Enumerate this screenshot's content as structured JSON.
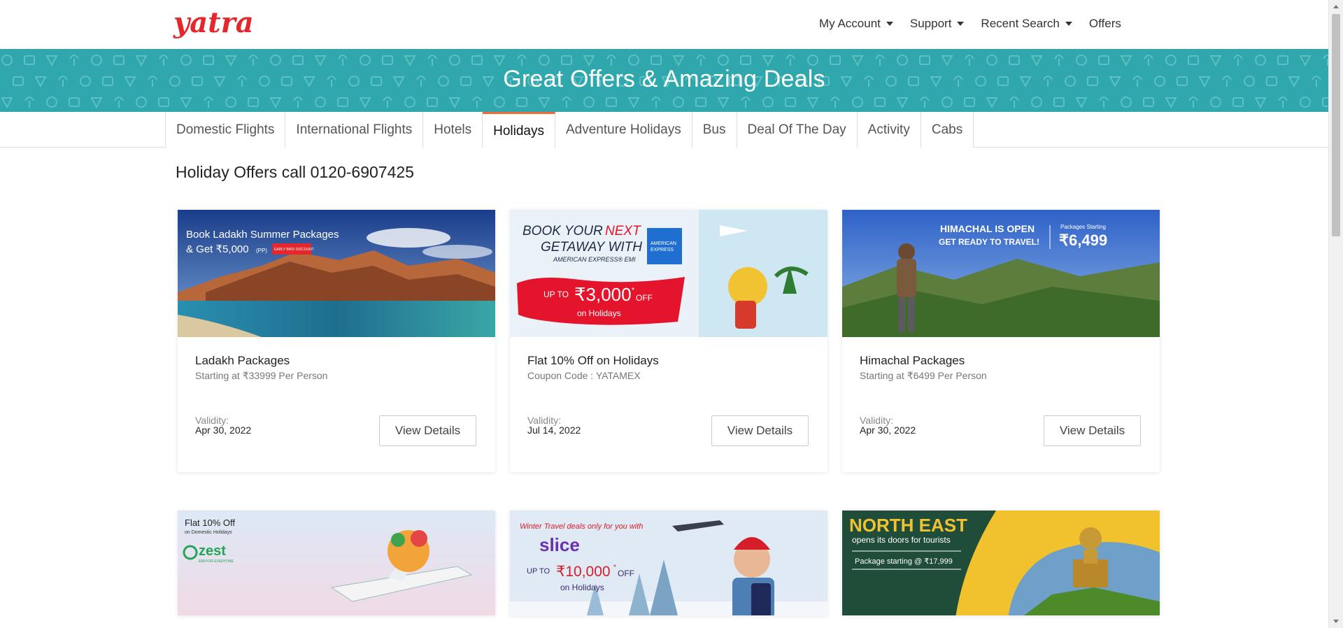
{
  "header": {
    "logo_text": "yatra",
    "nav": [
      {
        "label": "My Account",
        "dropdown": true
      },
      {
        "label": "Support",
        "dropdown": true
      },
      {
        "label": "Recent Search",
        "dropdown": true
      },
      {
        "label": "Offers",
        "dropdown": false
      }
    ]
  },
  "banner": {
    "title": "Great Offers & Amazing Deals",
    "color": "#2fa7ac"
  },
  "tabs": [
    {
      "label": "Domestic Flights",
      "active": false
    },
    {
      "label": "International Flights",
      "active": false
    },
    {
      "label": "Hotels",
      "active": false
    },
    {
      "label": "Holidays",
      "active": true
    },
    {
      "label": "Adventure Holidays",
      "active": false
    },
    {
      "label": "Bus",
      "active": false
    },
    {
      "label": "Deal Of The Day",
      "active": false
    },
    {
      "label": "Activity",
      "active": false
    },
    {
      "label": "Cabs",
      "active": false
    }
  ],
  "section_title": "Holiday Offers call 0120-6907425",
  "offers": [
    {
      "image_text": [
        "Book Ladakh Summer Packages",
        "& Get ₹5,000",
        "(PP)",
        "EARLY BIRD DISCOUNT"
      ],
      "title": "Ladakh Packages",
      "subtitle": "Starting at ₹33999 Per Person",
      "validity_label": "Validity:",
      "validity_date": "Apr 30, 2022",
      "button": "View Details"
    },
    {
      "image_text": [
        "BOOK YOUR",
        "NEXT",
        "GETAWAY WITH",
        "AMERICAN EXPRESS® EMI",
        "UP TO",
        "₹3,000",
        "*",
        "OFF",
        "on Holidays",
        "AMERICAN",
        "EXPRESS"
      ],
      "title": "Flat 10% Off on Holidays",
      "subtitle": "Coupon Code : YATAMEX",
      "validity_label": "Validity:",
      "validity_date": "Jul 14, 2022",
      "button": "View Details"
    },
    {
      "image_text": [
        "HIMACHAL IS OPEN",
        "GET READY TO TRAVEL!",
        "Packages Starting",
        "₹6,499"
      ],
      "title": "Himachal Packages",
      "subtitle": "Starting at ₹6499 Per Person",
      "validity_label": "Validity:",
      "validity_date": "Apr 30, 2022",
      "button": "View Details"
    }
  ],
  "offers_row2": [
    {
      "image_text": [
        "Flat 10% Off",
        "on Domestic Holidays",
        "zest",
        "EMI FOR EVERYONE"
      ]
    },
    {
      "image_text": [
        "Winter Travel deals only for you with",
        "slice",
        "UP TO",
        "₹10,000",
        "*",
        "OFF",
        "on Holidays"
      ]
    },
    {
      "image_text": [
        "NORTH EAST",
        "opens its doors for tourists",
        "Package starting @ ₹17,999"
      ]
    }
  ]
}
